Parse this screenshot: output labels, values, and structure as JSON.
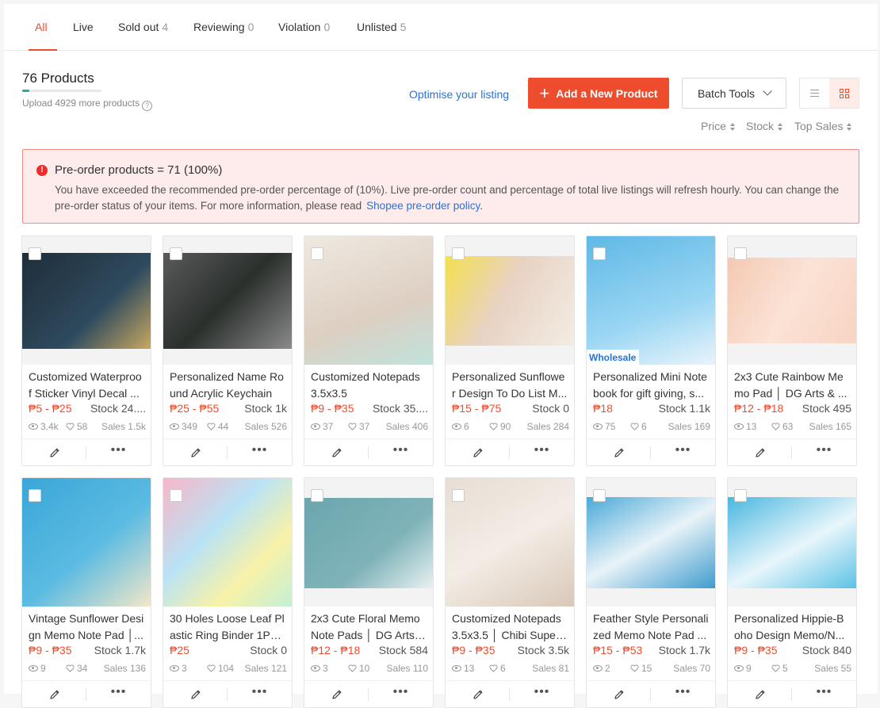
{
  "tabs": [
    {
      "label": "All",
      "count": ""
    },
    {
      "label": "Live",
      "count": ""
    },
    {
      "label": "Sold out",
      "count": "4"
    },
    {
      "label": "Reviewing",
      "count": "0"
    },
    {
      "label": "Violation",
      "count": "0"
    },
    {
      "label": "Unlisted",
      "count": "5"
    }
  ],
  "summary": {
    "title": "76 Products",
    "upload_hint": "Upload 4929 more products",
    "help_icon": "?",
    "progress": 0.015
  },
  "toolbar": {
    "optimise_label": "Optimise your listing",
    "add_label": "Add a New Product",
    "add_icon": "+",
    "batch_label": "Batch Tools"
  },
  "sorts": [
    "Price",
    "Stock",
    "Top Sales"
  ],
  "alert": {
    "icon": "!",
    "title": "Pre-order products = 71 (100%)",
    "body": "You have exceeded the recommended pre-order percentage of (10%). Live pre-order count and percentage of total live listings will refresh hourly. You can change the pre-order status of your items. For more information, please read",
    "link": "Shopee pre-order policy",
    "link_suffix": "."
  },
  "colors": {
    "accent": "#ee4d2d",
    "link": "#2673dd",
    "alert_bg": "#fdeceb"
  },
  "products": [
    {
      "title1": "Customized Waterproo",
      "title2": "f Sticker Vinyl Decal ...",
      "price": "₱5 - ₱25",
      "stock": "Stock 24....",
      "views": "3.4k",
      "likes": "58",
      "sales": "Sales 1.5k",
      "wholesale": ""
    },
    {
      "title1": "Personalized Name Ro",
      "title2": "und Acrylic Keychain",
      "price": "₱25 - ₱55",
      "stock": "Stock 1k",
      "views": "349",
      "likes": "44",
      "sales": "Sales 526",
      "wholesale": ""
    },
    {
      "title1": "Customized Notepads",
      "title2": "3.5x3.5",
      "price": "₱9 - ₱35",
      "stock": "Stock 35....",
      "views": "37",
      "likes": "37",
      "sales": "Sales 406",
      "wholesale": ""
    },
    {
      "title1": "Personalized Sunflowe",
      "title2": "r Design To Do List M...",
      "price": "₱15 - ₱75",
      "stock": "Stock 0",
      "views": "6",
      "likes": "90",
      "sales": "Sales 284",
      "wholesale": ""
    },
    {
      "title1": "Personalized Mini Note",
      "title2": "book for gift giving, s...",
      "price": "₱18",
      "stock": "Stock 1.1k",
      "views": "75",
      "likes": "6",
      "sales": "Sales 169",
      "wholesale": "Wholesale"
    },
    {
      "title1": "2x3 Cute Rainbow Me",
      "title2": "mo Pad │ DG Arts & ...",
      "price": "₱12 - ₱18",
      "stock": "Stock 495",
      "views": "13",
      "likes": "63",
      "sales": "Sales 165",
      "wholesale": ""
    },
    {
      "title1": "Vintage Sunflower Desi",
      "title2": "gn Memo Note Pad │...",
      "price": "₱9 - ₱35",
      "stock": "Stock 1.7k",
      "views": "9",
      "likes": "34",
      "sales": "Sales 136",
      "wholesale": ""
    },
    {
      "title1": "30 Holes Loose Leaf Pl",
      "title2": "astic Ring Binder 1PC...",
      "price": "₱25",
      "stock": "Stock 0",
      "views": "3",
      "likes": "104",
      "sales": "Sales 121",
      "wholesale": ""
    },
    {
      "title1": "2x3 Cute Floral Memo",
      "title2": "Note Pads │ DG Arts ...",
      "price": "₱12 - ₱18",
      "stock": "Stock 584",
      "views": "3",
      "likes": "10",
      "sales": "Sales 110",
      "wholesale": ""
    },
    {
      "title1": "Customized Notepads",
      "title2": "3.5x3.5 │ Chibi Super...",
      "price": "₱9 - ₱35",
      "stock": "Stock 3.5k",
      "views": "13",
      "likes": "6",
      "sales": "Sales 81",
      "wholesale": ""
    },
    {
      "title1": "Feather Style Personali",
      "title2": "zed Memo Note Pad ...",
      "price": "₱15 - ₱53",
      "stock": "Stock 1.7k",
      "views": "2",
      "likes": "15",
      "sales": "Sales 70",
      "wholesale": ""
    },
    {
      "title1": "Personalized Hippie-B",
      "title2": "oho Design Memo/N...",
      "price": "₱9 - ₱35",
      "stock": "Stock 840",
      "views": "9",
      "likes": "5",
      "sales": "Sales 55",
      "wholesale": ""
    }
  ]
}
